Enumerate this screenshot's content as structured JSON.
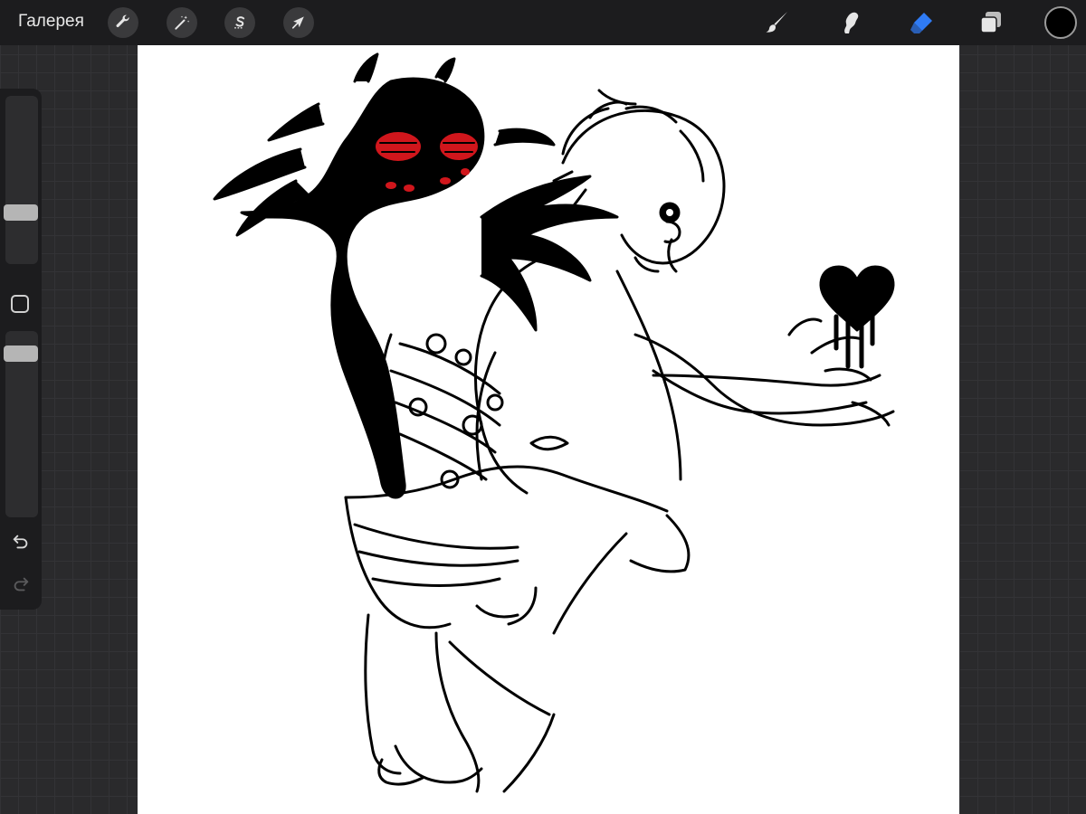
{
  "topbar": {
    "gallery_label": "Галерея",
    "actions_icon": "wrench-icon",
    "adjustments_icon": "magic-wand-icon",
    "selection_icon": "selection-s-icon",
    "transform_icon": "arrow-cursor-icon",
    "brush_icon": "brush-icon",
    "smudge_icon": "smudge-icon",
    "eraser_icon": "eraser-icon",
    "layers_icon": "layers-icon",
    "active_tool": "eraser",
    "current_color": "#000000",
    "accent_color": "#2f7bf5"
  },
  "sidebar": {
    "brush_size_level": 0.45,
    "opacity_level": 1.0,
    "undo_icon": "undo-icon",
    "redo_icon": "redo-icon",
    "modify_icon": "square-icon"
  },
  "canvas": {
    "background": "#ffffff",
    "artwork": "line-art-illustration",
    "highlight_color": "#d0161c"
  }
}
